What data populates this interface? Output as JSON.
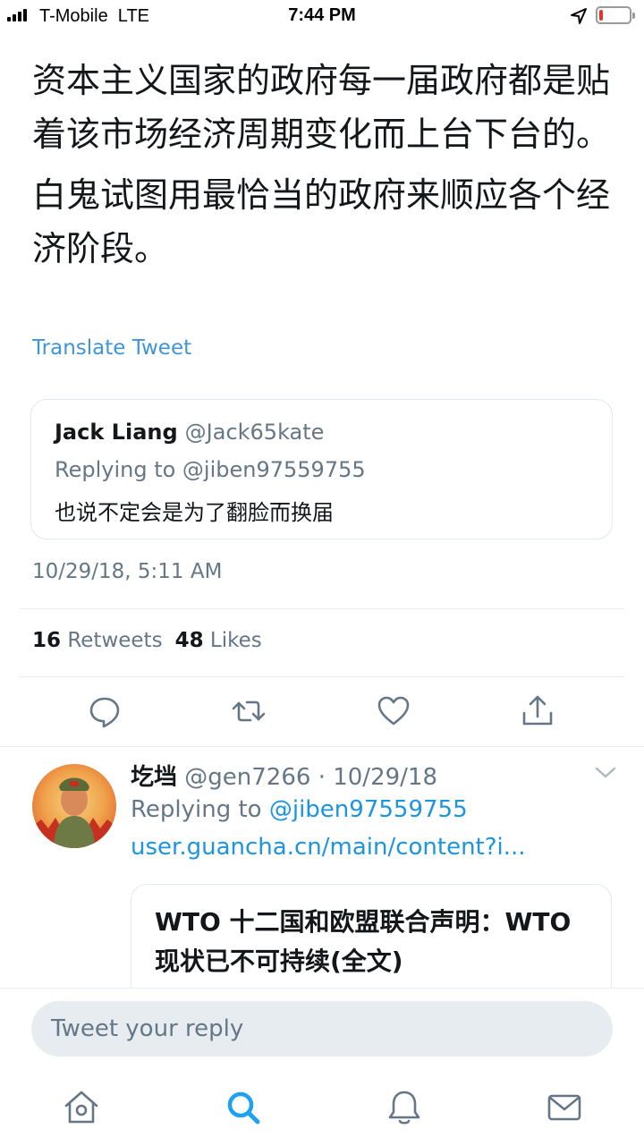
{
  "status_bar": {
    "carrier": "T-Mobile  LTE",
    "time": "7:44 PM",
    "battery_level": 0.12
  },
  "tweet": {
    "paragraph1": "资本主义国家的政府每一届政府都是贴着该市场经济周期变化而上台下台的。",
    "paragraph2": "白鬼试图用最恰当的政府来顺应各个经济阶段。",
    "translate_label": "Translate Tweet",
    "quoted": {
      "name": "Jack Liang",
      "handle": "@Jack65kate",
      "replying_to": "Replying to @jiben97559755",
      "text": "也说不定会是为了翻脸而换届"
    },
    "timestamp": "10/29/18, 5:11 AM",
    "retweets_count": "16",
    "retweets_label": "Retweets",
    "likes_count": "48",
    "likes_label": "Likes"
  },
  "actions": {
    "reply_icon": "speech-bubble-icon",
    "retweet_icon": "retweet-icon",
    "like_icon": "heart-icon",
    "share_icon": "share-icon"
  },
  "reply": {
    "name": "圪垱",
    "meta": "@gen7266 · 10/29/18",
    "replying_prefix": "Replying to ",
    "replying_handle": "@jiben97559755",
    "link": "user.guancha.cn/main/content?i...",
    "card_title": "WTO 十二国和欧盟联合声明：WTO现状已不可持续(全文)"
  },
  "composer": {
    "placeholder": "Tweet your reply"
  },
  "tab_bar": {
    "items": [
      "home-icon",
      "search-icon",
      "notifications-icon",
      "messages-icon"
    ],
    "active_color": "#1da1f2",
    "inactive_color": "#657786"
  },
  "colors": {
    "link": "#1b95e0",
    "secondary_text": "#657786",
    "primary_text": "#14171a"
  }
}
